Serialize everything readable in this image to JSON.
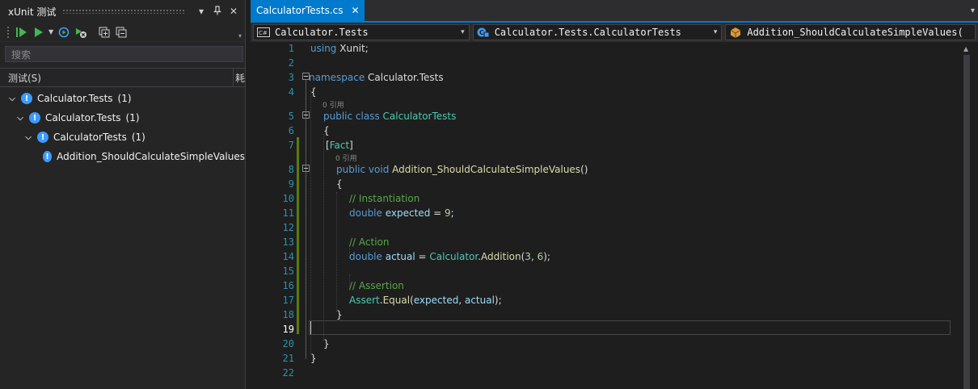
{
  "test_explorer": {
    "title": "xUnit 测试",
    "pin_icon": "pin-icon",
    "close_glyph": "✕",
    "dropdown_glyph": "▾",
    "search_placeholder": "搜索",
    "column_header": "测试(S)",
    "column_header2": "耗",
    "tree": [
      {
        "label": "Calculator.Tests",
        "count": "(1)",
        "level": 0,
        "expanded": true
      },
      {
        "label": "Calculator.Tests",
        "count": "(1)",
        "level": 1,
        "expanded": true
      },
      {
        "label": "CalculatorTests",
        "count": "(1)",
        "level": 2,
        "expanded": true
      },
      {
        "label": "Addition_ShouldCalculateSimpleValues",
        "count": "",
        "level": 3,
        "expanded": false
      }
    ],
    "status_icon": "warning-icon",
    "accent_color": "#3b9cff"
  },
  "editor": {
    "tab_label": "CalculatorTests.cs",
    "tab_close": "✕",
    "nav": {
      "project": "Calculator.Tests",
      "type": "Calculator.Tests.CalculatorTests",
      "member": "Addition_ShouldCalculateSimpleValues("
    },
    "lens_text": "0 引用",
    "current_line": 19,
    "accent_color": "#007acc"
  },
  "code_lines": [
    {
      "n": "1",
      "tokens": [
        [
          "kw",
          "using"
        ],
        [
          "pl",
          " Xunit;"
        ]
      ]
    },
    {
      "n": "2",
      "tokens": []
    },
    {
      "n": "3",
      "tokens": [
        [
          "kw",
          "namespace"
        ],
        [
          "pl",
          " Calculator.Tests"
        ]
      ]
    },
    {
      "n": "4",
      "tokens": [
        [
          "pl",
          "{"
        ]
      ]
    },
    {
      "n": "5",
      "tokens": [
        [
          "kw",
          "public class"
        ],
        [
          "pl",
          " "
        ],
        [
          "ty",
          "CalculatorTests"
        ]
      ]
    },
    {
      "n": "6",
      "tokens": [
        [
          "pl",
          "{"
        ]
      ]
    },
    {
      "n": "7",
      "tokens": [
        [
          "pl",
          "["
        ],
        [
          "attr",
          "Fact"
        ],
        [
          "pl",
          "]"
        ]
      ]
    },
    {
      "n": "8",
      "tokens": [
        [
          "kw",
          "public void"
        ],
        [
          "pl",
          " "
        ],
        [
          "fn",
          "Addition_ShouldCalculateSimpleValues"
        ],
        [
          "pl",
          "()"
        ]
      ]
    },
    {
      "n": "9",
      "tokens": [
        [
          "pl",
          "{"
        ]
      ]
    },
    {
      "n": "10",
      "tokens": [
        [
          "cm",
          "// Instantiation"
        ]
      ]
    },
    {
      "n": "11",
      "tokens": [
        [
          "kw",
          "double"
        ],
        [
          "pl",
          " "
        ],
        [
          "vr",
          "expected"
        ],
        [
          "pl",
          " = "
        ],
        [
          "nm",
          "9"
        ],
        [
          "pl",
          ";"
        ]
      ]
    },
    {
      "n": "12",
      "tokens": []
    },
    {
      "n": "13",
      "tokens": [
        [
          "cm",
          "// Action"
        ]
      ]
    },
    {
      "n": "14",
      "tokens": [
        [
          "kw",
          "double"
        ],
        [
          "pl",
          " "
        ],
        [
          "vr",
          "actual"
        ],
        [
          "pl",
          " = "
        ],
        [
          "ty",
          "Calculator"
        ],
        [
          "pl",
          "."
        ],
        [
          "fn",
          "Addition"
        ],
        [
          "pl",
          "("
        ],
        [
          "nm",
          "3"
        ],
        [
          "pl",
          ", "
        ],
        [
          "nm",
          "6"
        ],
        [
          "pl",
          ");"
        ]
      ]
    },
    {
      "n": "15",
      "tokens": []
    },
    {
      "n": "16",
      "tokens": [
        [
          "cm",
          "// Assertion"
        ]
      ]
    },
    {
      "n": "17",
      "tokens": [
        [
          "ty",
          "Assert"
        ],
        [
          "pl",
          "."
        ],
        [
          "fn",
          "Equal"
        ],
        [
          "pl",
          "("
        ],
        [
          "vr",
          "expected"
        ],
        [
          "pl",
          ", "
        ],
        [
          "vr",
          "actual"
        ],
        [
          "pl",
          ");"
        ]
      ]
    },
    {
      "n": "18",
      "tokens": [
        [
          "pl",
          "}"
        ]
      ]
    },
    {
      "n": "19",
      "tokens": []
    },
    {
      "n": "20",
      "tokens": [
        [
          "pl",
          "}"
        ]
      ]
    },
    {
      "n": "21",
      "tokens": [
        [
          "pl",
          "}"
        ]
      ]
    },
    {
      "n": "22",
      "tokens": []
    }
  ]
}
